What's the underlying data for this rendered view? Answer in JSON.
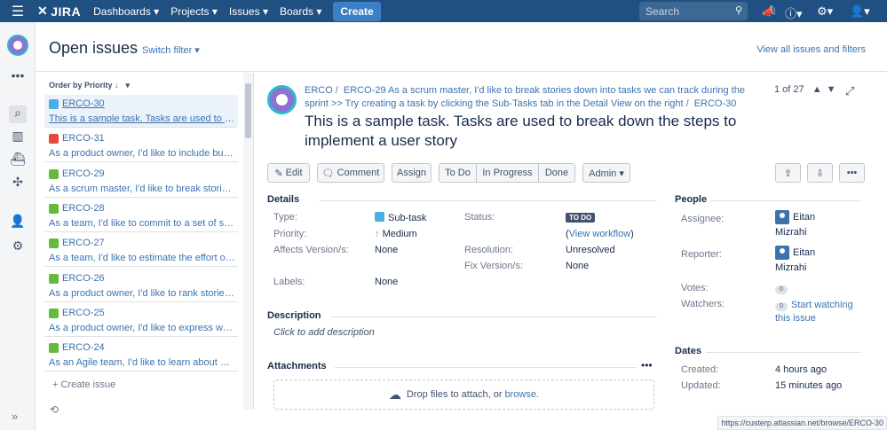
{
  "topbar": {
    "logo": "JIRA",
    "nav": [
      "Dashboards ▾",
      "Projects ▾",
      "Issues ▾",
      "Boards ▾"
    ],
    "create": "Create",
    "search_placeholder": "Search"
  },
  "header": {
    "title": "Open issues",
    "switch_filter": "Switch filter ▾",
    "view_all": "View all issues and filters"
  },
  "list": {
    "order_by": "Order by Priority ↓",
    "items": [
      {
        "key": "ERCO-30",
        "summary": "This is a sample task. Tasks are used to break down the steps to implement a user story",
        "type": "subtask",
        "color": "#4bade8"
      },
      {
        "key": "ERCO-31",
        "summary": "As a product owner, I'd like to include bugs, tasks and other issue types in my backlog",
        "type": "bug",
        "color": "#e5493a"
      },
      {
        "key": "ERCO-29",
        "summary": "As a scrum master, I'd like to break stories down into tasks we can track during the sprint",
        "type": "story",
        "color": "#63ba3c"
      },
      {
        "key": "ERCO-28",
        "summary": "As a team, I'd like to commit to a set of stories to be completed in a sprint",
        "type": "story",
        "color": "#63ba3c"
      },
      {
        "key": "ERCO-27",
        "summary": "As a team, I'd like to estimate the effort of a story in Story Points",
        "type": "story",
        "color": "#63ba3c"
      },
      {
        "key": "ERCO-26",
        "summary": "As a product owner, I'd like to rank stories in the backlog",
        "type": "story",
        "color": "#63ba3c"
      },
      {
        "key": "ERCO-25",
        "summary": "As a product owner, I'd like to express work in terms of actual user problems",
        "type": "story",
        "color": "#63ba3c"
      },
      {
        "key": "ERCO-24",
        "summary": "As an Agile team, I'd like to learn about Scrum",
        "type": "story",
        "color": "#63ba3c"
      }
    ],
    "create_issue": "+ Create issue"
  },
  "issue": {
    "breadcrumb_project": "ERCO",
    "breadcrumb_parent": "ERCO-29 As a scrum master, I'd like to break stories down into tasks we can track during the sprint >> Try creating a task by clicking the Sub-Tasks tab in the Detail View on the right",
    "breadcrumb_key": "ERCO-30",
    "pager": "1 of 27",
    "title": "This is a sample task. Tasks are used to break down the steps to implement a user story",
    "buttons": {
      "edit": "Edit",
      "comment": "Comment",
      "assign": "Assign",
      "todo": "To Do",
      "inprogress": "In Progress",
      "done": "Done",
      "admin": "Admin ▾"
    },
    "details": {
      "heading": "Details",
      "type_label": "Type:",
      "type_value": "Sub-task",
      "priority_label": "Priority:",
      "priority_value": "Medium",
      "affects_label": "Affects Version/s:",
      "affects_value": "None",
      "labels_label": "Labels:",
      "labels_value": "None",
      "status_label": "Status:",
      "status_value": "TO DO",
      "view_workflow": "View workflow",
      "resolution_label": "Resolution:",
      "resolution_value": "Unresolved",
      "fix_label": "Fix Version/s:",
      "fix_value": "None"
    },
    "description": {
      "heading": "Description",
      "placeholder": "Click to add description"
    },
    "attachments": {
      "heading": "Attachments",
      "drop_text": "Drop files to attach, or ",
      "browse": "browse."
    },
    "people": {
      "heading": "People",
      "assignee_label": "Assignee:",
      "assignee_first": "Eitan",
      "assignee_last": "Mizrahi",
      "reporter_label": "Reporter:",
      "reporter_first": "Eitan",
      "reporter_last": "Mizrahi",
      "votes_label": "Votes:",
      "votes_value": "0",
      "watchers_label": "Watchers:",
      "watchers_value": "0",
      "watch_line1": "Start watching",
      "watch_line2": "this issue"
    },
    "dates": {
      "heading": "Dates",
      "created_label": "Created:",
      "created_value": "4 hours ago",
      "updated_label": "Updated:",
      "updated_value": "15 minutes ago"
    }
  },
  "status_url": "https://custerp.atlassian.net/browse/ERCO-30"
}
